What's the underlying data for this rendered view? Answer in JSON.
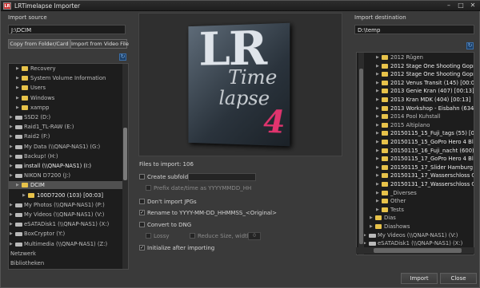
{
  "window": {
    "title": "LRTimelapse Importer",
    "controls": [
      "–",
      "□",
      "✕"
    ]
  },
  "import_source": {
    "label": "Import source",
    "path": "J:\\DCIM",
    "tabs": [
      "Copy from Folder/Card",
      "Import from Video File"
    ],
    "tree": [
      {
        "label": "Recovery",
        "icon": "folder-icon",
        "level": 1,
        "bright": false
      },
      {
        "label": "System Volume Information",
        "icon": "folder-icon",
        "level": 1,
        "bright": false
      },
      {
        "label": "Users",
        "icon": "folder-icon",
        "level": 1,
        "bright": false
      },
      {
        "label": "Windows",
        "icon": "folder-icon",
        "level": 1,
        "bright": false
      },
      {
        "label": "xampp",
        "icon": "folder-icon",
        "level": 1,
        "bright": false
      },
      {
        "label": "SSD2 (D:)",
        "icon": "drive-icon",
        "level": 0,
        "bright": false
      },
      {
        "label": "Raid1_TL-RAW (E:)",
        "icon": "drive-icon",
        "level": 0,
        "bright": false
      },
      {
        "label": "Raid2 (F:)",
        "icon": "drive-icon",
        "level": 0,
        "bright": false
      },
      {
        "label": "My Data (\\\\QNAP-NAS1) (G:)",
        "icon": "drive-icon",
        "level": 0,
        "bright": false
      },
      {
        "label": "Backup! (H:)",
        "icon": "drive-icon",
        "level": 0,
        "bright": false
      },
      {
        "label": "install (\\\\QNAP-NAS1) (I:)",
        "icon": "drive-icon",
        "level": 0,
        "bright": true
      },
      {
        "label": "NIKON D7200 (J:)",
        "icon": "drive-icon",
        "level": 0,
        "bright": false
      },
      {
        "label": "DCIM",
        "icon": "folder-icon",
        "level": 1,
        "bright": true,
        "selected": true
      },
      {
        "label": "100D7200 (103) [00:03]",
        "icon": "folder-icon",
        "level": 2,
        "bright": true
      },
      {
        "label": "My Photos (\\\\QNAP-NAS1) (P:)",
        "icon": "drive-icon",
        "level": 0,
        "bright": false
      },
      {
        "label": "My Videos (\\\\QNAP-NAS1) (V:)",
        "icon": "drive-icon",
        "level": 0,
        "bright": false
      },
      {
        "label": "eSATADisk1 (\\\\QNAP-NAS1) (X:)",
        "icon": "drive-icon",
        "level": 0,
        "bright": false
      },
      {
        "label": "BoxCryptor (Y:)",
        "icon": "drive-icon",
        "level": 0,
        "bright": false
      },
      {
        "label": "Multimedia (\\\\QNAP-NAS1) (Z:)",
        "icon": "drive-icon",
        "level": 0,
        "bright": false
      },
      {
        "label": "Netzwerk",
        "icon": "",
        "level": 0,
        "bright": false
      },
      {
        "label": "Bibliotheken",
        "icon": "",
        "level": 0,
        "bright": false
      }
    ]
  },
  "preview": {
    "letters": "LR",
    "word1": "Time",
    "word2": "lapse",
    "number": "4"
  },
  "options": {
    "files_to_import_label": "Files to import:",
    "files_to_import_count": "106",
    "create_subfolder": "Create subfolder",
    "prefix_date": "Prefix date/time as YYYYMMDD_HH",
    "dont_import_jpgs": "Don't import JPGs",
    "rename_to": "Rename to YYYY-MM-DD_HHMMSS_<Original>",
    "convert_dng": "Convert to DNG",
    "lossy": "Lossy",
    "reduce_size": "Reduce Size, width:",
    "reduce_width": "0",
    "init_after": "Initialize after importing"
  },
  "import_destination": {
    "label": "Import destination",
    "path": "D:\\temp",
    "tree": [
      {
        "label": "2012 Rügen",
        "level": 1,
        "bright": false
      },
      {
        "label": "2012 Stage One Shooting Gopro",
        "level": 1,
        "bright": true
      },
      {
        "label": "2012 Stage One Shooting Gopro",
        "level": 1,
        "bright": true
      },
      {
        "label": "2012 Venus Transit (145) [00:04]",
        "level": 1,
        "bright": true
      },
      {
        "label": "2013 Genie Kran (407) [00:13]",
        "level": 1,
        "bright": true
      },
      {
        "label": "2013 Kran MDK (404) [00:13]",
        "level": 1,
        "bright": true
      },
      {
        "label": "2013 Workshop - Eisbahn (634)",
        "level": 1,
        "bright": true
      },
      {
        "label": "2014 Pool Kuhstall",
        "level": 1,
        "bright": false
      },
      {
        "label": "2015 Altiplano",
        "level": 1,
        "bright": false
      },
      {
        "label": "20150115_15_Fuji_tags (55) [00",
        "level": 1,
        "bright": true
      },
      {
        "label": "20150115_15_GoPro Hero 4 Bl",
        "level": 1,
        "bright": true
      },
      {
        "label": "20150115_16_Fuji_nacht (600)",
        "level": 1,
        "bright": true
      },
      {
        "label": "20150115_17_GoPro Hero 4 Bl",
        "level": 1,
        "bright": true
      },
      {
        "label": "20150115_17_Slider Hamburg E",
        "level": 1,
        "bright": true
      },
      {
        "label": "20150131_17_Wasserschloss G",
        "level": 1,
        "bright": true
      },
      {
        "label": "20150131_17_Wasserschloss G",
        "level": 1,
        "bright": true
      },
      {
        "label": "_Diverses",
        "level": 1,
        "bright": false
      },
      {
        "label": "Other",
        "level": 1,
        "bright": false
      },
      {
        "label": "Tests",
        "level": 1,
        "bright": false
      },
      {
        "label": "Dias",
        "level": 0,
        "bright": false
      },
      {
        "label": "Diashows",
        "level": 0,
        "bright": false
      },
      {
        "label": "My Videos (\\\\QNAP-NAS1) (V:)",
        "level": -1,
        "bright": false
      },
      {
        "label": "eSATADisk1 (\\\\QNAP-NAS1) (X:)",
        "level": -1,
        "bright": false
      }
    ]
  },
  "buttons": {
    "import": "Import",
    "close": "Close"
  }
}
